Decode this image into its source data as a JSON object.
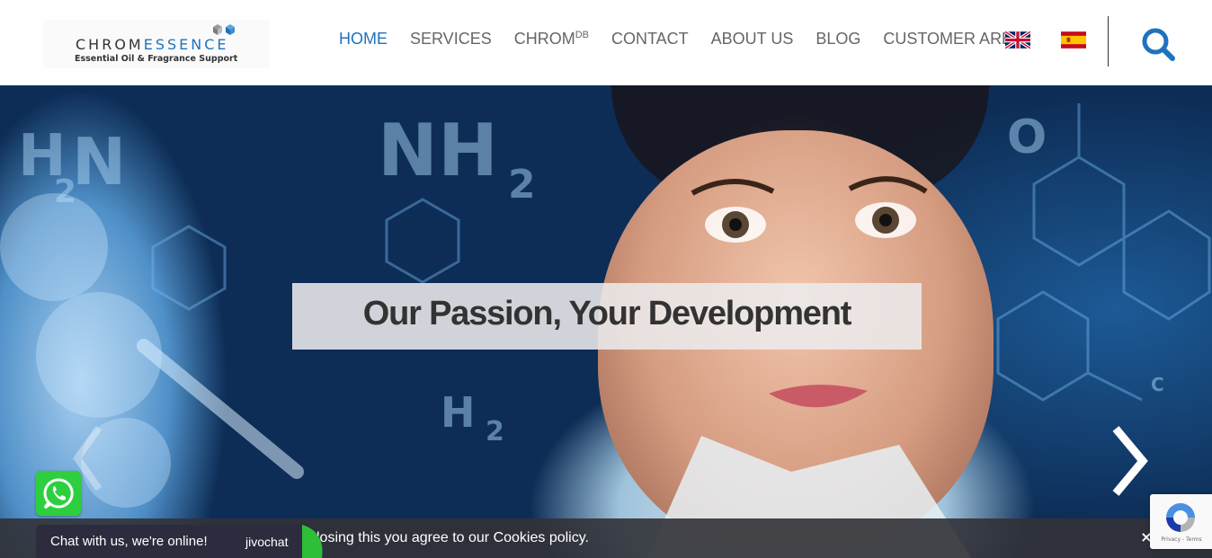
{
  "header": {
    "logo": {
      "word_a": "CHROM",
      "word_b": "ESSENCE",
      "tagline": "Essential Oil & Fragrance Support"
    },
    "nav": [
      {
        "label": "HOME",
        "active": true
      },
      {
        "label": "SERVICES",
        "active": false
      },
      {
        "label": "CHROM",
        "sup": "DB",
        "active": false
      },
      {
        "label": "CONTACT",
        "active": false
      },
      {
        "label": "ABOUT US",
        "active": false
      },
      {
        "label": "BLOG",
        "active": false
      },
      {
        "label": "CUSTOMER AREA",
        "active": false
      }
    ],
    "languages": [
      {
        "icon": "uk-flag-icon"
      },
      {
        "icon": "spain-flag-icon"
      }
    ],
    "search_icon": "search-icon"
  },
  "hero": {
    "caption": "Our Passion, Your Development",
    "prev_icon": "chevron-left-icon",
    "next_icon": "chevron-right-icon"
  },
  "cookie": {
    "text": "losing this you agree to our Cookies policy.",
    "close": "×"
  },
  "chat": {
    "label": "Chat with us, we're online!",
    "brand": "jivochat"
  },
  "recaptcha": {
    "links": "Privacy - Terms"
  },
  "colors": {
    "accent": "#1e73be",
    "nav_text": "#666666",
    "whatsapp": "#2ecf3f",
    "chat_bg": "#2c2c3e",
    "jivochat_green": "#2dbe3a"
  }
}
